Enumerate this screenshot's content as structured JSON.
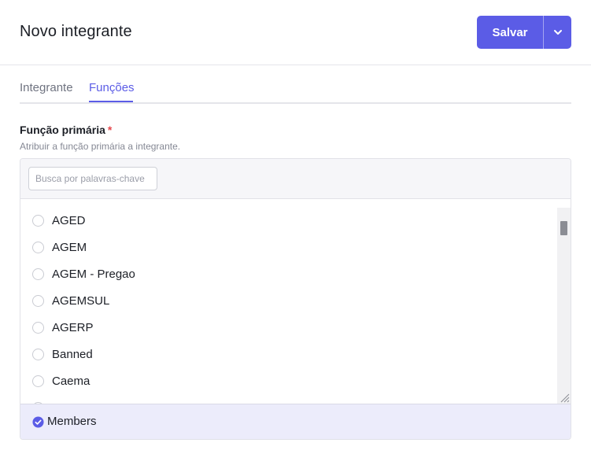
{
  "header": {
    "title": "Novo integrante",
    "save_label": "Salvar",
    "caret_icon": "chevron-down-icon"
  },
  "tabs": [
    {
      "label": "Integrante",
      "active": false
    },
    {
      "label": "Funções",
      "active": true
    }
  ],
  "field": {
    "label": "Função primária",
    "required_mark": "*",
    "help": "Atribuir a função primária a integrante."
  },
  "search": {
    "placeholder": "Busca por palavras-chave",
    "value": ""
  },
  "options": [
    {
      "label": "AGED",
      "selected": false
    },
    {
      "label": "AGEM",
      "selected": false
    },
    {
      "label": "AGEM - Pregao",
      "selected": false
    },
    {
      "label": "AGEMSUL",
      "selected": false
    },
    {
      "label": "AGERP",
      "selected": false
    },
    {
      "label": "Banned",
      "selected": false
    },
    {
      "label": "Caema",
      "selected": false
    }
  ],
  "footer": {
    "label": "Members",
    "icon": "check-circle-icon",
    "checked": true
  },
  "colors": {
    "accent": "#5b5ce6",
    "required": "#e5484d",
    "footer_bg": "#ececfb"
  }
}
